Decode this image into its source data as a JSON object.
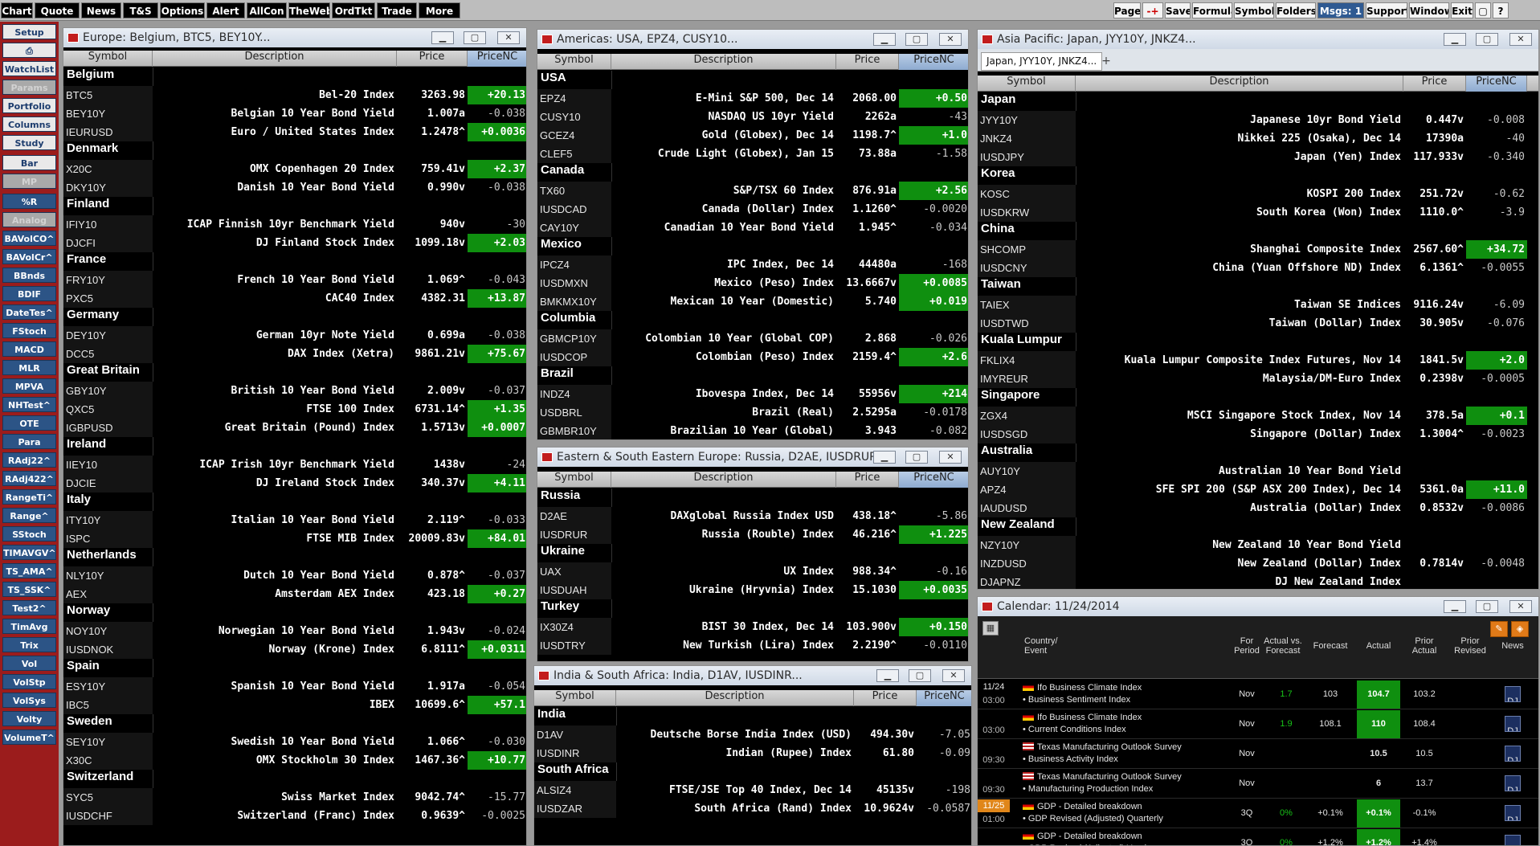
{
  "topbar": {
    "left": [
      "Chart",
      "Quote",
      "News",
      "T&S",
      "Options",
      "Alert",
      "AllCon",
      "TheWeb",
      "OrdTkt",
      "Trade",
      "More"
    ],
    "right": [
      "Page",
      "-+",
      "Save",
      "Formula",
      "Symbols",
      "Folders",
      "Msgs: 1",
      "Support",
      "Window",
      "Exit",
      "▢",
      "?"
    ]
  },
  "sidebar": [
    "Setup",
    "⎙",
    "WatchList",
    "Params",
    "Portfolio",
    "Columns",
    "Study",
    "Bar",
    "MP",
    "%R",
    "Analog",
    "BAVolCO^",
    "BAVolCr^",
    "BBnds",
    "BDIF",
    "DateTes^",
    "FStoch",
    "MACD",
    "MLR",
    "MPVA",
    "NHTest^",
    "OTE",
    "Para",
    "RAdj22^",
    "RAdj422^",
    "RangeTi^",
    "Range^",
    "SStoch",
    "TIMAVGV^",
    "TS_AMA^",
    "TS_SSK^",
    "Test2^",
    "TimAvg",
    "Trix",
    "Vol",
    "VolStp",
    "VolSys",
    "Volty",
    "VolumeT^"
  ],
  "columns": {
    "symbol": "Symbol",
    "description": "Description",
    "price": "Price",
    "pricenc": "PriceNC"
  },
  "europe": {
    "title": "Europe: Belgium, BTC5, BEY10Y...",
    "rows": [
      {
        "g": "Belgium"
      },
      {
        "s": "BTC5",
        "d": "Bel-20 Index",
        "p": "3263.98",
        "c": "+20.13",
        "u": 1
      },
      {
        "s": "BEY10Y",
        "d": "Belgian 10 Year Bond Yield",
        "p": "1.007a",
        "c": "-0.038"
      },
      {
        "s": "IEURUSD",
        "d": "Euro / United States Index",
        "p": "1.2478^",
        "c": "+0.0036",
        "u": 1
      },
      {
        "g": "Denmark"
      },
      {
        "s": "X20C",
        "d": "OMX Copenhagen 20 Index",
        "p": "759.41v",
        "c": "+2.37",
        "u": 1
      },
      {
        "s": "DKY10Y",
        "d": "Danish 10 Year Bond Yield",
        "p": "0.990v",
        "c": "-0.038"
      },
      {
        "g": "Finland"
      },
      {
        "s": "IFIY10",
        "d": "ICAP Finnish 10yr Benchmark Yield",
        "p": "940v",
        "c": "-30"
      },
      {
        "s": "DJCFI",
        "d": "DJ Finland Stock Index",
        "p": "1099.18v",
        "c": "+2.03",
        "u": 1
      },
      {
        "g": "France"
      },
      {
        "s": "FRY10Y",
        "d": "French 10 Year Bond Yield",
        "p": "1.069^",
        "c": "-0.043"
      },
      {
        "s": "PXC5",
        "d": "CAC40 Index",
        "p": "4382.31",
        "c": "+13.87",
        "u": 1
      },
      {
        "g": "Germany"
      },
      {
        "s": "DEY10Y",
        "d": "German 10yr Note Yield",
        "p": "0.699a",
        "c": "-0.038"
      },
      {
        "s": "DCC5",
        "d": "DAX Index (Xetra)",
        "p": "9861.21v",
        "c": "+75.67",
        "u": 1
      },
      {
        "g": "Great Britain"
      },
      {
        "s": "GBY10Y",
        "d": "British 10 Year Bond Yield",
        "p": "2.009v",
        "c": "-0.037"
      },
      {
        "s": "QXC5",
        "d": "FTSE 100 Index",
        "p": "6731.14^",
        "c": "+1.35",
        "u": 1
      },
      {
        "s": "IGBPUSD",
        "d": "Great Britain (Pound) Index",
        "p": "1.5713v",
        "c": "+0.0007",
        "u": 1
      },
      {
        "g": "Ireland"
      },
      {
        "s": "IIEY10",
        "d": "ICAP Irish 10yr Benchmark Yield",
        "p": "1438v",
        "c": "-24"
      },
      {
        "s": "DJCIE",
        "d": "DJ Ireland Stock Index",
        "p": "340.37v",
        "c": "+4.11",
        "u": 1
      },
      {
        "g": "Italy"
      },
      {
        "s": "ITY10Y",
        "d": "Italian 10 Year Bond Yield",
        "p": "2.119^",
        "c": "-0.033"
      },
      {
        "s": "ISPC",
        "d": "FTSE MIB Index",
        "p": "20009.83v",
        "c": "+84.01",
        "u": 1
      },
      {
        "g": "Netherlands"
      },
      {
        "s": "NLY10Y",
        "d": "Dutch 10 Year Bond Yield",
        "p": "0.878^",
        "c": "-0.037"
      },
      {
        "s": "AEX",
        "d": "Amsterdam AEX Index",
        "p": "423.18",
        "c": "+0.27",
        "u": 1
      },
      {
        "g": "Norway"
      },
      {
        "s": "NOY10Y",
        "d": "Norwegian 10 Year Bond Yield",
        "p": "1.943v",
        "c": "-0.024"
      },
      {
        "s": "IUSDNOK",
        "d": "Norway (Krone) Index",
        "p": "6.8111^",
        "c": "+0.0311",
        "u": 1
      },
      {
        "g": "Spain"
      },
      {
        "s": "ESY10Y",
        "d": "Spanish 10 Year Bond Yield",
        "p": "1.917a",
        "c": "-0.054"
      },
      {
        "s": "IBC5",
        "d": "IBEX",
        "p": "10699.6^",
        "c": "+57.1",
        "u": 1
      },
      {
        "g": "Sweden"
      },
      {
        "s": "SEY10Y",
        "d": "Swedish 10 Year Bond Yield",
        "p": "1.066^",
        "c": "-0.030"
      },
      {
        "s": "X30C",
        "d": "OMX Stockholm 30 Index",
        "p": "1467.36^",
        "c": "+10.77",
        "u": 1
      },
      {
        "g": "Switzerland"
      },
      {
        "s": "SYC5",
        "d": "Swiss Market Index",
        "p": "9042.74^",
        "c": "-15.77"
      },
      {
        "s": "IUSDCHF",
        "d": "Switzerland (Franc) Index",
        "p": "0.9639^",
        "c": "-0.0025"
      }
    ]
  },
  "americas": {
    "title": "Americas: USA, EPZ4, CUSY10...",
    "rows": [
      {
        "g": "USA"
      },
      {
        "s": "EPZ4",
        "d": "E-Mini S&P 500, Dec 14",
        "p": "2068.00",
        "c": "+0.50",
        "u": 1
      },
      {
        "s": "CUSY10",
        "d": "NASDAQ US 10yr Yield",
        "p": "2262a",
        "c": "-43"
      },
      {
        "s": "GCEZ4",
        "d": "Gold (Globex), Dec 14",
        "p": "1198.7^",
        "c": "+1.0",
        "u": 1
      },
      {
        "s": "CLEF5",
        "d": "Crude Light (Globex), Jan 15",
        "p": "73.88a",
        "c": "-1.58"
      },
      {
        "g": "Canada"
      },
      {
        "s": "TX60",
        "d": "S&P/TSX 60 Index",
        "p": "876.91a",
        "c": "+2.56",
        "u": 1
      },
      {
        "s": "IUSDCAD",
        "d": "Canada (Dollar) Index",
        "p": "1.1260^",
        "c": "-0.0020"
      },
      {
        "s": "CAY10Y",
        "d": "Canadian 10 Year Bond Yield",
        "p": "1.945^",
        "c": "-0.034"
      },
      {
        "g": "Mexico"
      },
      {
        "s": "IPCZ4",
        "d": "IPC Index, Dec 14",
        "p": "44480a",
        "c": "-168"
      },
      {
        "s": "IUSDMXN",
        "d": "Mexico (Peso) Index",
        "p": "13.6667v",
        "c": "+0.0085",
        "u": 1
      },
      {
        "s": "BMKMX10Y",
        "d": "Mexican 10 Year (Domestic)",
        "p": "5.740",
        "c": "+0.019",
        "u": 1
      },
      {
        "g": "Columbia"
      },
      {
        "s": "GBMCP10Y",
        "d": "Colombian 10 Year (Global COP)",
        "p": "2.868",
        "c": "-0.026"
      },
      {
        "s": "IUSDCOP",
        "d": "Colombian (Peso) Index",
        "p": "2159.4^",
        "c": "+2.6",
        "u": 1
      },
      {
        "g": "Brazil"
      },
      {
        "s": "INDZ4",
        "d": "Ibovespa Index, Dec 14",
        "p": "55956v",
        "c": "+214",
        "u": 1
      },
      {
        "s": "USDBRL",
        "d": "Brazil (Real)",
        "p": "2.5295a",
        "c": "-0.0178"
      },
      {
        "s": "GBMBR10Y",
        "d": "Brazilian 10 Year (Global)",
        "p": "3.943",
        "c": "-0.082"
      }
    ]
  },
  "eastern": {
    "title": "Eastern & South Eastern Europe: Russia, D2AE, IUSDRUR...",
    "rows": [
      {
        "g": "Russia"
      },
      {
        "s": "D2AE",
        "d": "DAXglobal Russia Index USD",
        "p": "438.18^",
        "c": "-5.86"
      },
      {
        "s": "IUSDRUR",
        "d": "Russia (Rouble) Index",
        "p": "46.216^",
        "c": "+1.225",
        "u": 1
      },
      {
        "g": "Ukraine"
      },
      {
        "s": "UAX",
        "d": "UX Index",
        "p": "988.34^",
        "c": "-0.16"
      },
      {
        "s": "IUSDUAH",
        "d": "Ukraine (Hryvnia) Index",
        "p": "15.1030",
        "c": "+0.0035",
        "u": 1
      },
      {
        "g": "Turkey"
      },
      {
        "s": "IX30Z4",
        "d": "BIST 30 Index, Dec 14",
        "p": "103.900v",
        "c": "+0.150",
        "u": 1
      },
      {
        "s": "IUSDTRY",
        "d": "New Turkish (Lira) Index",
        "p": "2.2190^",
        "c": "-0.0110"
      }
    ]
  },
  "india": {
    "title": "India & South Africa: India, D1AV, IUSDINR...",
    "rows": [
      {
        "g": "India"
      },
      {
        "s": "D1AV",
        "d": "Deutsche Borse India Index (USD)",
        "p": "494.30v",
        "c": "-7.05"
      },
      {
        "s": "IUSDINR",
        "d": "Indian (Rupee) Index",
        "p": "61.80",
        "c": "-0.09"
      },
      {
        "g": "South Africa"
      },
      {
        "s": "ALSIZ4",
        "d": "FTSE/JSE Top 40 Index, Dec 14",
        "p": "45135v",
        "c": "-198"
      },
      {
        "s": "IUSDZAR",
        "d": "South Africa (Rand) Index",
        "p": "10.9624v",
        "c": "-0.0587"
      }
    ]
  },
  "asia": {
    "title": "Asia Pacific: Japan, JYY10Y, JNKZ4...",
    "tab": "Japan, JYY10Y, JNKZ4...",
    "rows": [
      {
        "g": "Japan"
      },
      {
        "s": "JYY10Y",
        "d": "Japanese 10yr Bond Yield",
        "p": "0.447v",
        "c": "-0.008"
      },
      {
        "s": "JNKZ4",
        "d": "Nikkei 225 (Osaka), Dec 14",
        "p": "17390a",
        "c": "-40"
      },
      {
        "s": "IUSDJPY",
        "d": "Japan (Yen) Index",
        "p": "117.933v",
        "c": "-0.340"
      },
      {
        "g": "Korea"
      },
      {
        "s": "KOSC",
        "d": "KOSPI 200 Index",
        "p": "251.72v",
        "c": "-0.62"
      },
      {
        "s": "IUSDKRW",
        "d": "South Korea (Won) Index",
        "p": "1110.0^",
        "c": "-3.9"
      },
      {
        "g": "China"
      },
      {
        "s": "SHCOMP",
        "d": "Shanghai Composite Index",
        "p": "2567.60^",
        "c": "+34.72",
        "u": 1
      },
      {
        "s": "IUSDCNY",
        "d": "China (Yuan Offshore ND) Index",
        "p": "6.1361^",
        "c": "-0.0055"
      },
      {
        "g": "Taiwan"
      },
      {
        "s": "TAIEX",
        "d": "Taiwan SE Indices",
        "p": "9116.24v",
        "c": "-6.09"
      },
      {
        "s": "IUSDTWD",
        "d": "Taiwan (Dollar) Index",
        "p": "30.905v",
        "c": "-0.076"
      },
      {
        "g": "Kuala Lumpur"
      },
      {
        "s": "FKLIX4",
        "d": "Kuala Lumpur Composite Index Futures, Nov 14",
        "p": "1841.5v",
        "c": "+2.0",
        "u": 1
      },
      {
        "s": "IMYREUR",
        "d": "Malaysia/DM-Euro Index",
        "p": "0.2398v",
        "c": "-0.0005"
      },
      {
        "g": "Singapore"
      },
      {
        "s": "ZGX4",
        "d": "MSCI Singapore Stock Index, Nov 14",
        "p": "378.5a",
        "c": "+0.1",
        "u": 1
      },
      {
        "s": "IUSDSGD",
        "d": "Singapore (Dollar) Index",
        "p": "1.3004^",
        "c": "-0.0023"
      },
      {
        "g": "Australia"
      },
      {
        "s": "AUY10Y",
        "d": "Australian 10 Year Bond Yield",
        "p": "",
        "c": ""
      },
      {
        "s": "APZ4",
        "d": "SFE SPI 200 (S&P ASX 200 Index), Dec 14",
        "p": "5361.0a",
        "c": "+11.0",
        "u": 1
      },
      {
        "s": "IAUDUSD",
        "d": "Australia (Dollar) Index",
        "p": "0.8532v",
        "c": "-0.0086"
      },
      {
        "g": "New Zealand"
      },
      {
        "s": "NZY10Y",
        "d": "New Zealand 10 Year Bond Yield",
        "p": "",
        "c": ""
      },
      {
        "s": "INZDUSD",
        "d": "New Zealand (Dollar) Index",
        "p": "0.7814v",
        "c": "-0.0048"
      },
      {
        "s": "DJAPNZ",
        "d": "DJ New Zealand Index",
        "p": "",
        "c": ""
      }
    ]
  },
  "calendar": {
    "title": "Calendar: 11/24/2014",
    "headers": {
      "country": "Country/",
      "event": "Event",
      "for": "For",
      "period": "Period",
      "avf": "Actual vs.",
      "avf2": "Forecast",
      "forecast": "Forecast",
      "actual": "Actual",
      "prior": "Prior",
      "prior2": "Actual",
      "revised": "Prior",
      "revised2": "Revised",
      "news": "News"
    },
    "rows": [
      {
        "date": "11/24",
        "time": "03:00",
        "flag": "de",
        "e1": "Ifo Business Climate Index",
        "e2": "• Business Sentiment Index",
        "per": "Nov",
        "avf": "1.7",
        "fc": "103",
        "act": "104.7",
        "pr": "103.2",
        "rev": "",
        "news": "DJ"
      },
      {
        "date": "",
        "time": "03:00",
        "flag": "de",
        "e1": "Ifo Business Climate Index",
        "e2": "• Current Conditions Index",
        "per": "Nov",
        "avf": "1.9",
        "fc": "108.1",
        "act": "110",
        "pr": "108.4",
        "rev": "",
        "news": "DJ"
      },
      {
        "date": "",
        "time": "09:30",
        "flag": "us",
        "e1": "Texas Manufacturing Outlook Survey",
        "e2": "• Business Activity Index",
        "per": "Nov",
        "avf": "",
        "fc": "",
        "act": "10.5",
        "pr": "10.5",
        "rev": "",
        "news": "DJ"
      },
      {
        "date": "",
        "time": "09:30",
        "flag": "us",
        "e1": "Texas Manufacturing Outlook Survey",
        "e2": "• Manufacturing Production Index",
        "per": "Nov",
        "avf": "",
        "fc": "",
        "act": "6",
        "pr": "13.7",
        "rev": "",
        "news": "DJ"
      },
      {
        "date": "11/25",
        "time": "01:00",
        "flag": "de",
        "e1": "GDP - Detailed breakdown",
        "e2": "• GDP Revised (Adjusted) Quarterly",
        "per": "3Q",
        "avf": "0%",
        "fc": "+0.1%",
        "act": "+0.1%",
        "pr": "-0.1%",
        "rev": "",
        "news": "DJ"
      },
      {
        "date": "",
        "time": "01:00",
        "flag": "de",
        "e1": "GDP - Detailed breakdown",
        "e2": "• GDP Revised (Adjusted) Yearly",
        "per": "3Q",
        "avf": "0%",
        "fc": "+1.2%",
        "act": "+1.2%",
        "pr": "+1.4%",
        "rev": "",
        "news": "DJ"
      }
    ]
  }
}
